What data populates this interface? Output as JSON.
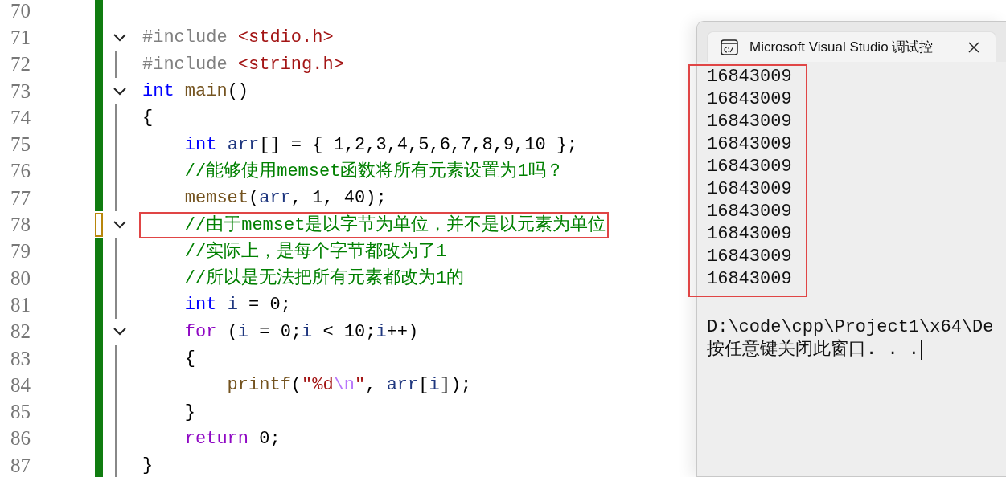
{
  "editor": {
    "lines": [
      {
        "number": "70",
        "saved": true,
        "foldable": false,
        "highlighted": false
      },
      {
        "number": "71",
        "saved": true,
        "foldable": true,
        "highlighted": false,
        "tokens": [
          {
            "kind": "preproc",
            "text": "#include "
          },
          {
            "kind": "string",
            "text": "<stdio.h>"
          }
        ]
      },
      {
        "number": "72",
        "saved": true,
        "foldable": false,
        "highlighted": false,
        "tokens": [
          {
            "kind": "preproc",
            "text": "#include "
          },
          {
            "kind": "string",
            "text": "<string.h>"
          }
        ]
      },
      {
        "number": "73",
        "saved": true,
        "foldable": true,
        "highlighted": false,
        "tokens": [
          {
            "kind": "keyword",
            "text": "int "
          },
          {
            "kind": "function",
            "text": "main"
          },
          {
            "kind": "plain",
            "text": "()"
          }
        ]
      },
      {
        "number": "74",
        "saved": true,
        "foldable": false,
        "highlighted": false,
        "tokens": [
          {
            "kind": "plain",
            "text": "{"
          }
        ]
      },
      {
        "number": "75",
        "saved": true,
        "foldable": false,
        "highlighted": false,
        "tokens": [
          {
            "kind": "keyword",
            "text": "    int "
          },
          {
            "kind": "ident",
            "text": "arr"
          },
          {
            "kind": "plain",
            "text": "[] = { 1,2,3,4,5,6,7,8,9,10 };"
          }
        ]
      },
      {
        "number": "76",
        "saved": true,
        "foldable": false,
        "highlighted": false,
        "tokens": [
          {
            "kind": "comment",
            "text": "    //能够使用memset函数将所有元素设置为1吗？"
          }
        ]
      },
      {
        "number": "77",
        "saved": true,
        "foldable": false,
        "highlighted": false,
        "tokens": [
          {
            "kind": "function",
            "text": "    memset"
          },
          {
            "kind": "plain",
            "text": "("
          },
          {
            "kind": "ident",
            "text": "arr"
          },
          {
            "kind": "plain",
            "text": ", 1, 40);"
          }
        ]
      },
      {
        "number": "78",
        "saved": false,
        "foldable": true,
        "highlighted": true,
        "tokens": [
          {
            "kind": "comment",
            "text": "    //由于memset是以字节为单位，并不是以元素为单位"
          }
        ]
      },
      {
        "number": "79",
        "saved": true,
        "foldable": false,
        "highlighted": false,
        "tokens": [
          {
            "kind": "comment",
            "text": "    //实际上，是每个字节都改为了1"
          }
        ]
      },
      {
        "number": "80",
        "saved": true,
        "foldable": false,
        "highlighted": false,
        "tokens": [
          {
            "kind": "comment",
            "text": "    //所以是无法把所有元素都改为1的"
          }
        ]
      },
      {
        "number": "81",
        "saved": true,
        "foldable": false,
        "highlighted": false,
        "tokens": [
          {
            "kind": "keyword",
            "text": "    int "
          },
          {
            "kind": "ident",
            "text": "i"
          },
          {
            "kind": "plain",
            "text": " = 0;"
          }
        ]
      },
      {
        "number": "82",
        "saved": true,
        "foldable": true,
        "highlighted": false,
        "tokens": [
          {
            "kind": "control",
            "text": "    for "
          },
          {
            "kind": "plain",
            "text": "("
          },
          {
            "kind": "ident",
            "text": "i"
          },
          {
            "kind": "plain",
            "text": " = 0;"
          },
          {
            "kind": "ident",
            "text": "i"
          },
          {
            "kind": "plain",
            "text": " < 10;"
          },
          {
            "kind": "ident",
            "text": "i"
          },
          {
            "kind": "plain",
            "text": "++)"
          }
        ]
      },
      {
        "number": "83",
        "saved": true,
        "foldable": false,
        "highlighted": false,
        "tokens": [
          {
            "kind": "plain",
            "text": "    {"
          }
        ]
      },
      {
        "number": "84",
        "saved": true,
        "foldable": false,
        "highlighted": false,
        "tokens": [
          {
            "kind": "function",
            "text": "        printf"
          },
          {
            "kind": "plain",
            "text": "("
          },
          {
            "kind": "string",
            "text": "\"%d"
          },
          {
            "kind": "escape",
            "text": "\\n"
          },
          {
            "kind": "string",
            "text": "\""
          },
          {
            "kind": "plain",
            "text": ", "
          },
          {
            "kind": "ident",
            "text": "arr"
          },
          {
            "kind": "plain",
            "text": "["
          },
          {
            "kind": "ident",
            "text": "i"
          },
          {
            "kind": "plain",
            "text": "]);"
          }
        ]
      },
      {
        "number": "85",
        "saved": true,
        "foldable": false,
        "highlighted": false,
        "tokens": [
          {
            "kind": "plain",
            "text": "    }"
          }
        ]
      },
      {
        "number": "86",
        "saved": true,
        "foldable": false,
        "highlighted": false,
        "tokens": [
          {
            "kind": "control",
            "text": "    return "
          },
          {
            "kind": "plain",
            "text": "0;"
          }
        ]
      },
      {
        "number": "87",
        "saved": true,
        "foldable": false,
        "highlighted": false,
        "tokens": [
          {
            "kind": "plain",
            "text": "}"
          }
        ]
      }
    ]
  },
  "console": {
    "title": "Microsoft Visual Studio 调试控",
    "output_highlighted": true,
    "output": [
      "16843009",
      "16843009",
      "16843009",
      "16843009",
      "16843009",
      "16843009",
      "16843009",
      "16843009",
      "16843009",
      "16843009"
    ],
    "path": "D:\\code\\cpp\\Project1\\x64\\De",
    "prompt": "按任意键关闭此窗口. . ."
  }
}
